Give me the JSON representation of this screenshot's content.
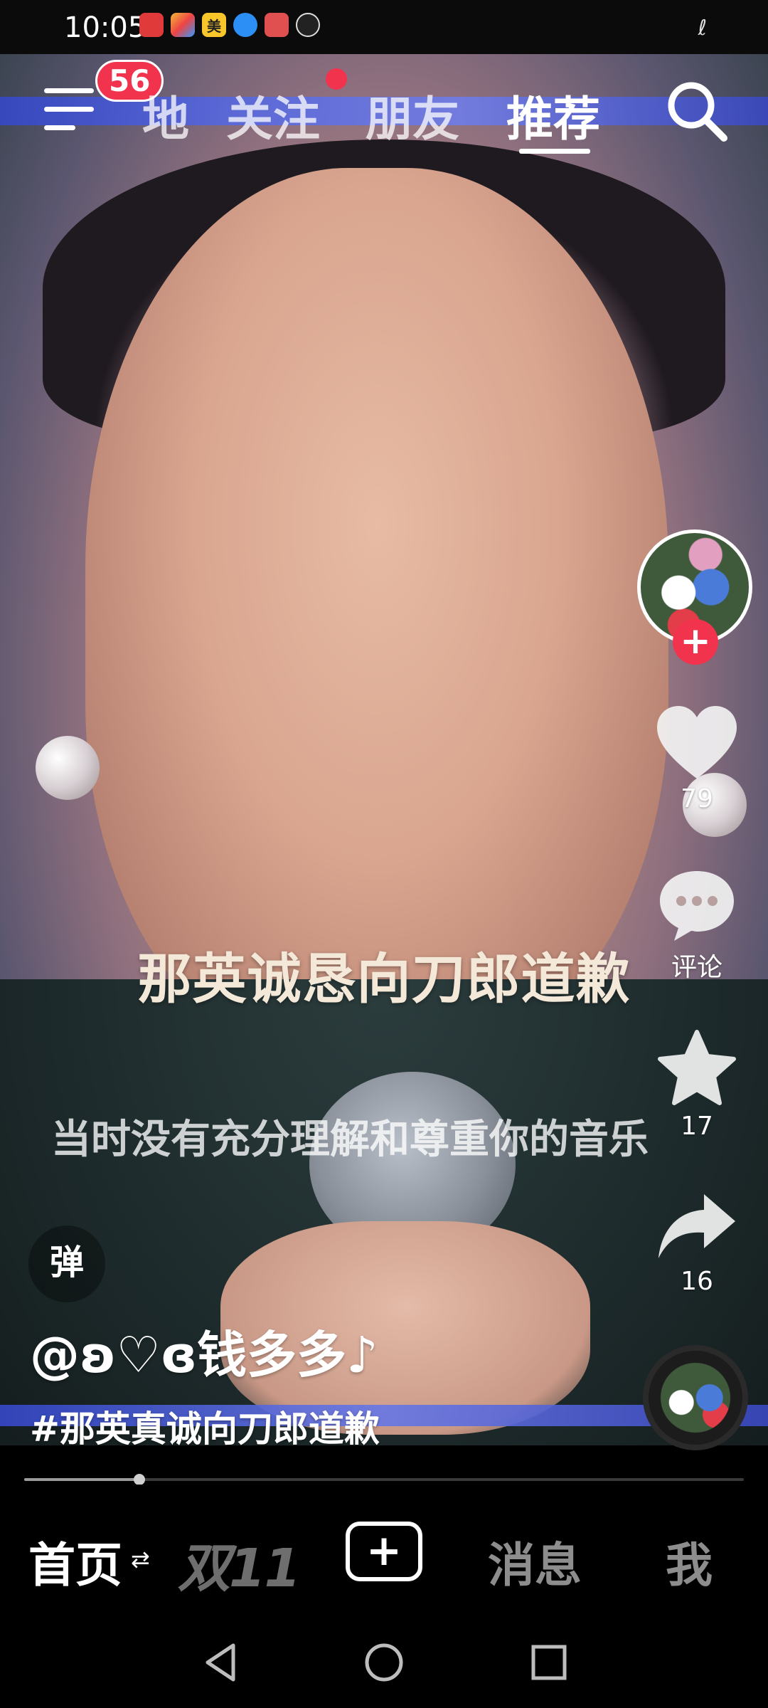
{
  "status_bar": {
    "time": "10:05",
    "icons": [
      "huawei-app-icon",
      "photos-icon",
      "meituan-icon",
      "browser-icon",
      "huawei-app-icon",
      "clock-icon"
    ],
    "meituan_label": "美",
    "right_glyph": "ℓ"
  },
  "top_nav": {
    "menu_badge": "56",
    "tabs": [
      {
        "label": "地",
        "active": false
      },
      {
        "label": "关注",
        "active": false
      },
      {
        "label": "朋友",
        "active": false
      },
      {
        "label": "推荐",
        "active": true
      }
    ],
    "follow_tab_has_dot": true,
    "dot_color": "#f2334e"
  },
  "video": {
    "subtitle_main": "那英诚恳向刀郎道歉",
    "subtitle_sub": "当时没有充分理解和尊重你的音乐"
  },
  "right_rail": {
    "follow_symbol": "+",
    "like_count": "79",
    "comment_label": "评论",
    "favorite_count": "17",
    "share_count": "16"
  },
  "post": {
    "danmu_label": "弹",
    "author": "@ʚ♡ɞ钱多多♪",
    "hashtag": "#那英真诚向刀郎道歉"
  },
  "progress": {
    "fraction": 0.16
  },
  "bottom_tabs": {
    "home": "首页",
    "home_switch": "⇄",
    "sale": "双11",
    "create": "+",
    "messages": "消息",
    "me": "我"
  },
  "colors": {
    "accent_red": "#f2334e",
    "background": "#000000"
  }
}
